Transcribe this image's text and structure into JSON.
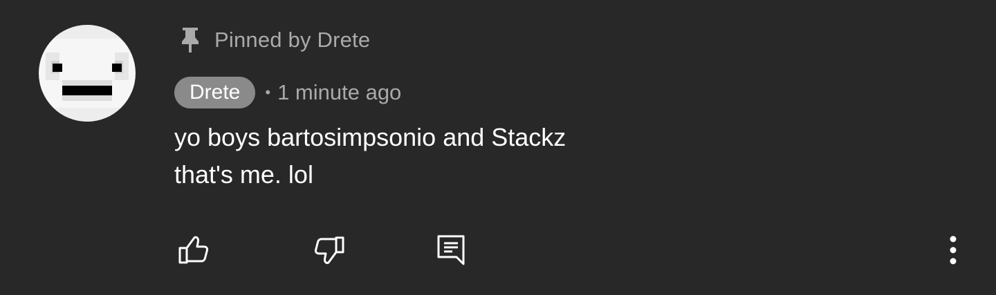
{
  "comment": {
    "avatar_icon": "pixel-face-avatar",
    "pinned_icon": "pin-icon",
    "pinned_text": "Pinned by Drete",
    "author": "Drete",
    "separator": "•",
    "timestamp": "1 minute ago",
    "text_lines": [
      "yo boys bartosimpsonio and Stackz",
      "that's me. lol"
    ]
  },
  "actions": {
    "like_icon": "thumbs-up-icon",
    "dislike_icon": "thumbs-down-icon",
    "reply_icon": "reply-comment-icon",
    "more_icon": "more-vertical-icon"
  },
  "colors": {
    "background": "#282828",
    "primary_text": "#ffffff",
    "secondary_text": "#aaaaaa",
    "author_chip": "#8a8a8a"
  }
}
